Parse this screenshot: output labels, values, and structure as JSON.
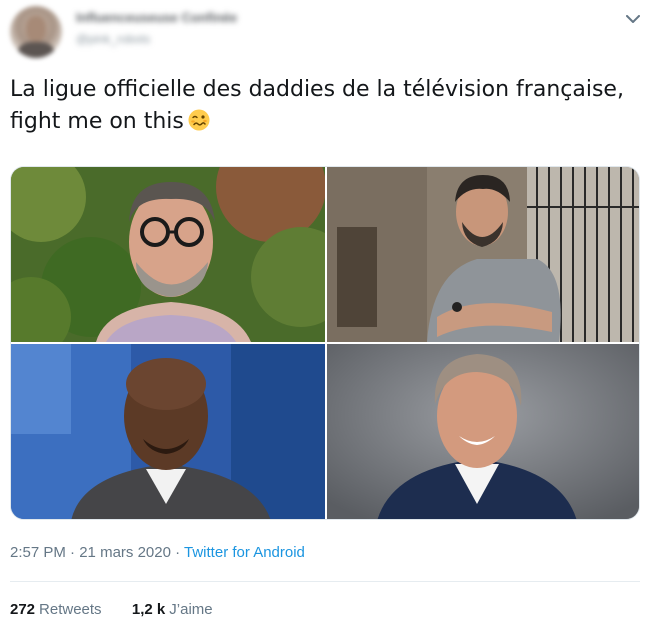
{
  "author": {
    "display_name": "Influenceuseuse Confinée",
    "handle": "@pink_robots",
    "avatar_icon": "person-avatar",
    "menu_icon": "chevron-down-icon"
  },
  "tweet": {
    "text_line1": "La ligue officielle des daddies de la télévision française,",
    "text_line2": "fight me on this",
    "emoji": "woozy-face-emoji"
  },
  "media": {
    "photos": [
      {
        "alt": "photo-1",
        "position": "top-left"
      },
      {
        "alt": "photo-2",
        "position": "top-right"
      },
      {
        "alt": "photo-3",
        "position": "bottom-left"
      },
      {
        "alt": "photo-4",
        "position": "bottom-right"
      }
    ]
  },
  "meta": {
    "time": "2:57 PM",
    "separator": " · ",
    "date": "21 mars 2020",
    "source": "Twitter for Android"
  },
  "stats": {
    "retweets_count": "272",
    "retweets_label": "Retweets",
    "likes_count": "1,2 k",
    "likes_label": "J’aime"
  },
  "colors": {
    "link_blue": "#1b95e0",
    "secondary_text": "#657786",
    "primary_text": "#14171a",
    "divider": "#e6ecf0"
  }
}
